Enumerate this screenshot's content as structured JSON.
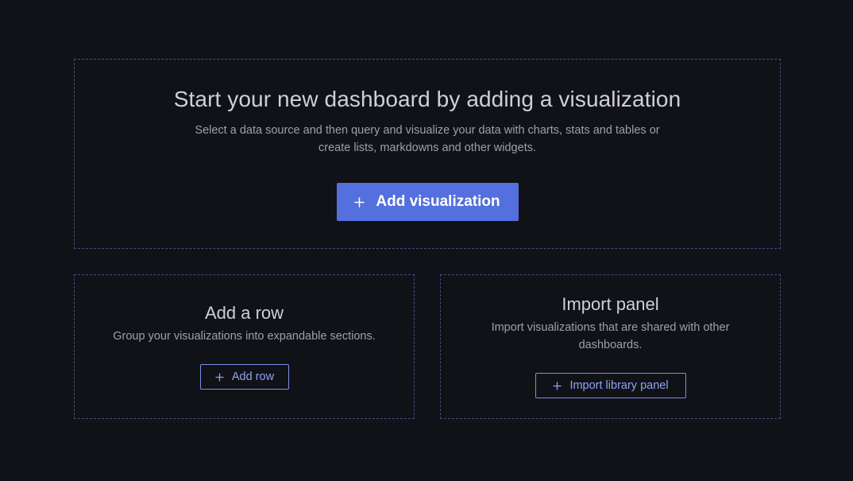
{
  "main": {
    "title": "Start your new dashboard by adding a visualization",
    "description": "Select a data source and then query and visualize your data with charts, stats and tables or create lists, markdowns and other widgets.",
    "button_label": "Add visualization",
    "button_icon": "plus-icon"
  },
  "row": {
    "title": "Add a row",
    "description": "Group your visualizations into expandable sections.",
    "button_label": "Add row",
    "button_icon": "plus-icon"
  },
  "import": {
    "title": "Import panel",
    "description": "Import visualizations that are shared with other dashboards.",
    "button_label": "Import library panel",
    "button_icon": "plus-icon"
  },
  "colors": {
    "background": "#111217",
    "primary": "#5470de",
    "outline_text": "#8ea2f4",
    "dashed_border": "#4a4a78"
  }
}
